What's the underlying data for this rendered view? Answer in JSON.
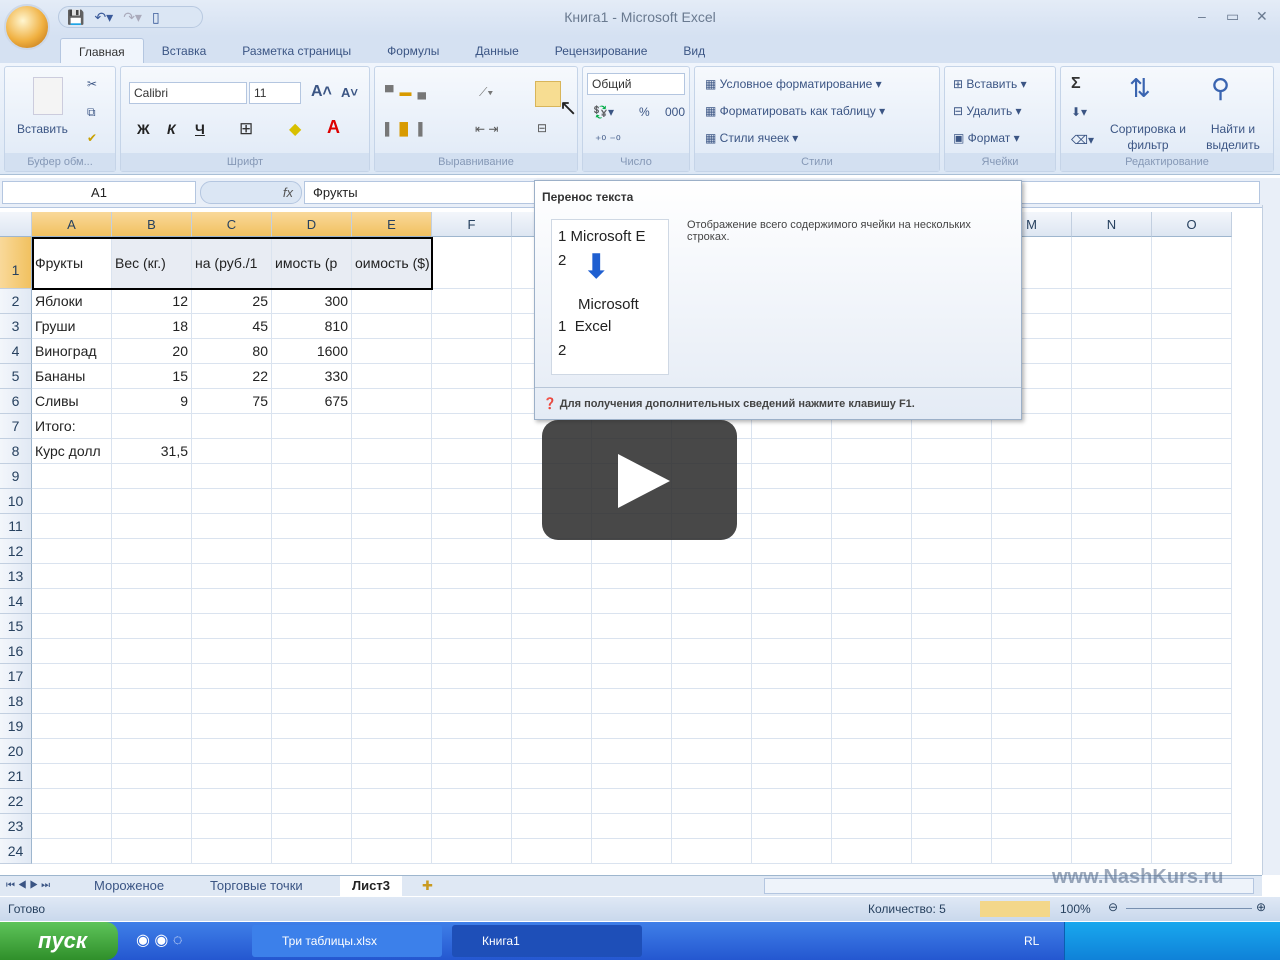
{
  "window": {
    "title": "Книга1 - Microsoft Excel"
  },
  "ribbon": {
    "tabs": [
      "Главная",
      "Вставка",
      "Разметка страницы",
      "Формулы",
      "Данные",
      "Рецензирование",
      "Вид"
    ],
    "clipboard": {
      "paste": "Вставить",
      "label": "Буфер обм..."
    },
    "font": {
      "name": "Calibri",
      "size": "11",
      "bold": "Ж",
      "italic": "К",
      "underline": "Ч",
      "label": "Шрифт"
    },
    "alignment": {
      "label": "Выравнивание"
    },
    "number": {
      "format": "Общий",
      "percent": "%",
      "thousands": "000",
      "label": "Число"
    },
    "styles": {
      "conditional": "Условное форматирование",
      "as_table": "Форматировать как таблицу",
      "cell_styles": "Стили ячеек",
      "label": "Стили"
    },
    "cells": {
      "insert": "Вставить",
      "delete": "Удалить",
      "format": "Формат",
      "label": "Ячейки"
    },
    "editing": {
      "sum": "Σ",
      "sort": "Сортировка и фильтр",
      "find": "Найти и выделить",
      "label": "Редактирование"
    }
  },
  "formula_bar": {
    "name_box": "A1",
    "fx": "fx",
    "value": "Фрукты"
  },
  "columns": [
    "A",
    "B",
    "C",
    "D",
    "E",
    "F",
    "G",
    "H",
    "I",
    "J",
    "K",
    "L",
    "M",
    "N",
    "O"
  ],
  "selected_columns": [
    "A",
    "B",
    "C",
    "D",
    "E"
  ],
  "rows": [
    [
      "Фрукты",
      "Вес (кг.)",
      "на (руб./1",
      "имость (р",
      "оимость ($)"
    ],
    [
      "Яблоки",
      "12",
      "25",
      "300"
    ],
    [
      "Груши",
      "18",
      "45",
      "810"
    ],
    [
      "Виноград",
      "20",
      "80",
      "1600"
    ],
    [
      "Бананы",
      "15",
      "22",
      "330"
    ],
    [
      "Сливы",
      "9",
      "75",
      "675"
    ],
    [
      "Итого:"
    ],
    [
      "Курс долл",
      "31,5"
    ]
  ],
  "row_count": 24,
  "tooltip": {
    "title": "Перенос текста",
    "sample_before": "Microsoft E",
    "sample_after_1": "Microsoft",
    "sample_after_2": "Excel",
    "description": "Отображение всего содержимого ячейки на нескольких строках.",
    "help": "Для получения дополнительных сведений нажмите клавишу F1."
  },
  "sheets": {
    "tabs": [
      "Мороженое",
      "Торговые точки",
      "Лист3"
    ],
    "active": "Лист3"
  },
  "status": {
    "ready": "Готово",
    "count": "Количество: 5",
    "zoom": "100%"
  },
  "taskbar": {
    "start": "пуск",
    "tasks": [
      "Три таблицы.xlsx",
      "Книга1"
    ],
    "lang": "RL"
  },
  "watermark": "www.NashKurs.ru",
  "colors": {
    "ribbon": "#dce7f5",
    "selected_header": "#f1c15f",
    "taskbar": "#2457d0",
    "start": "#3a9f35"
  }
}
